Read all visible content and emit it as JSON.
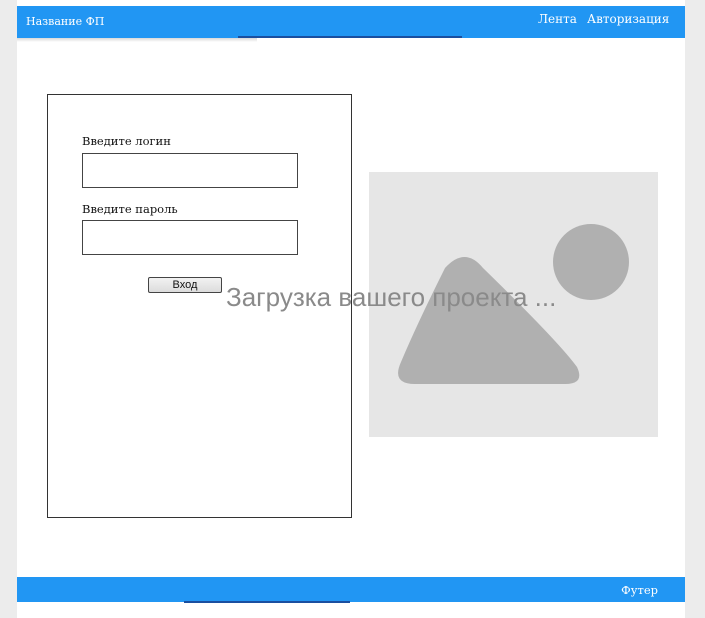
{
  "header": {
    "brand": "Название ФП",
    "nav": [
      {
        "label": "Лента"
      },
      {
        "label": "Авторизация"
      }
    ]
  },
  "login_form": {
    "login_label": "Введите логин",
    "login_value": "",
    "password_label": "Введите пароль",
    "password_value": "",
    "submit_label": "Вход"
  },
  "image_placeholder": {
    "icon": "image-placeholder-icon"
  },
  "loading_text": "Загрузка вашего проекта ...",
  "footer": {
    "text": "Футер"
  },
  "colors": {
    "accent": "#2196f3",
    "accent_dark": "#1a4fa0",
    "placeholder_bg": "#e6e6e6",
    "placeholder_shape": "#b0b0b0",
    "loading_text": "#8a8a8a"
  }
}
